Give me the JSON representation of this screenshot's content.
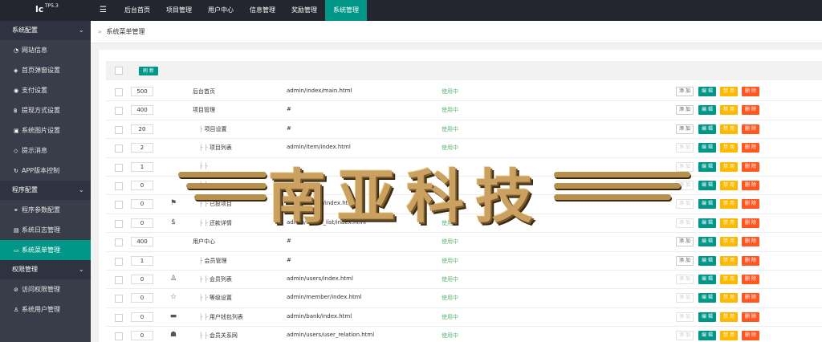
{
  "app": {
    "logo": "lc",
    "version": "TP5.3"
  },
  "topnav": {
    "menu_icon": "hamburger-icon",
    "items": [
      "后台首页",
      "项目管理",
      "用户中心",
      "信息管理",
      "奖励管理",
      "系统管理"
    ],
    "active_index": 5
  },
  "sidebar": {
    "groups": [
      {
        "label": "系统配置",
        "items": [
          {
            "label": "网站信息",
            "icon": "dashboard-icon"
          },
          {
            "label": "首页弹窗设置",
            "icon": "tag-icon"
          },
          {
            "label": "支付设置",
            "icon": "radio-icon"
          },
          {
            "label": "提现方式设置",
            "icon": "bitcoin-icon"
          },
          {
            "label": "系统图片设置",
            "icon": "image-icon"
          },
          {
            "label": "提示消息",
            "icon": "tag-icon"
          },
          {
            "label": "APP版本控制",
            "icon": "refresh-icon"
          }
        ]
      },
      {
        "label": "程序配置",
        "items": [
          {
            "label": "程序参数配置",
            "icon": "link-icon"
          },
          {
            "label": "系统日志管理",
            "icon": "list-icon"
          },
          {
            "label": "系统菜单管理",
            "icon": "window-icon"
          }
        ]
      },
      {
        "label": "权限管理",
        "items": [
          {
            "label": "访问权限管理",
            "icon": "check-circle-icon"
          },
          {
            "label": "系统用户管理",
            "icon": "user-icon"
          }
        ]
      }
    ],
    "active_item": "系统菜单管理"
  },
  "breadcrumb": {
    "separator": "»",
    "text": "系统菜单管理"
  },
  "toolbar": {
    "refresh_label": "刷 新"
  },
  "actions": {
    "add": "添 加",
    "edit": "编 辑",
    "disable": "禁 用",
    "delete": "删 除"
  },
  "rows": [
    {
      "sort": "500",
      "level": 0,
      "icon": "",
      "name": "后台首页",
      "url": "admin/index/main.html",
      "status": "使用中",
      "add_enabled": true
    },
    {
      "sort": "400",
      "level": 0,
      "icon": "",
      "name": "项目管理",
      "url": "#",
      "status": "使用中",
      "add_enabled": true
    },
    {
      "sort": "20",
      "level": 1,
      "icon": "",
      "name": "项目设置",
      "url": "#",
      "status": "使用中",
      "add_enabled": true
    },
    {
      "sort": "2",
      "level": 2,
      "icon": "",
      "name": "项目列表",
      "url": "admin/item/index.html",
      "status": "使用中",
      "add_enabled": false
    },
    {
      "sort": "1",
      "level": 2,
      "icon": "",
      "name": "",
      "url": "",
      "status": "",
      "add_enabled": false
    },
    {
      "sort": "0",
      "level": 2,
      "icon": "",
      "name": "",
      "url": "",
      "status": "",
      "add_enabled": false
    },
    {
      "sort": "0",
      "level": 2,
      "icon": "flag-icon",
      "name": "已投项目",
      "url": "admin/invest/index.html",
      "status": "使用中",
      "add_enabled": false
    },
    {
      "sort": "0",
      "level": 2,
      "icon": "dollar-icon",
      "name": "还款详情",
      "url": "admin/invest_list/index.html",
      "status": "使用中",
      "add_enabled": false
    },
    {
      "sort": "400",
      "level": 0,
      "icon": "",
      "name": "用户中心",
      "url": "#",
      "status": "使用中",
      "add_enabled": true
    },
    {
      "sort": "1",
      "level": 1,
      "icon": "",
      "name": "会员管理",
      "url": "#",
      "status": "使用中",
      "add_enabled": true
    },
    {
      "sort": "0",
      "level": 2,
      "icon": "user-icon",
      "name": "会员列表",
      "url": "admin/users/index.html",
      "status": "使用中",
      "add_enabled": false
    },
    {
      "sort": "0",
      "level": 2,
      "icon": "star-icon",
      "name": "等级设置",
      "url": "admin/member/index.html",
      "status": "使用中",
      "add_enabled": false
    },
    {
      "sort": "0",
      "level": 2,
      "icon": "card-icon",
      "name": "用户钱包列表",
      "url": "admin/bank/index.html",
      "status": "使用中",
      "add_enabled": false
    },
    {
      "sort": "0",
      "level": 2,
      "icon": "group-icon",
      "name": "会员关系网",
      "url": "admin/users/user_relation.html",
      "status": "使用中",
      "add_enabled": false
    }
  ],
  "watermark": {
    "text": "南亚科技"
  },
  "colors": {
    "topbar": "#23262e",
    "sidebar": "#393d49",
    "accent": "#009688",
    "warn": "#ffb800",
    "danger": "#ff5722",
    "status": "#5fb878"
  }
}
